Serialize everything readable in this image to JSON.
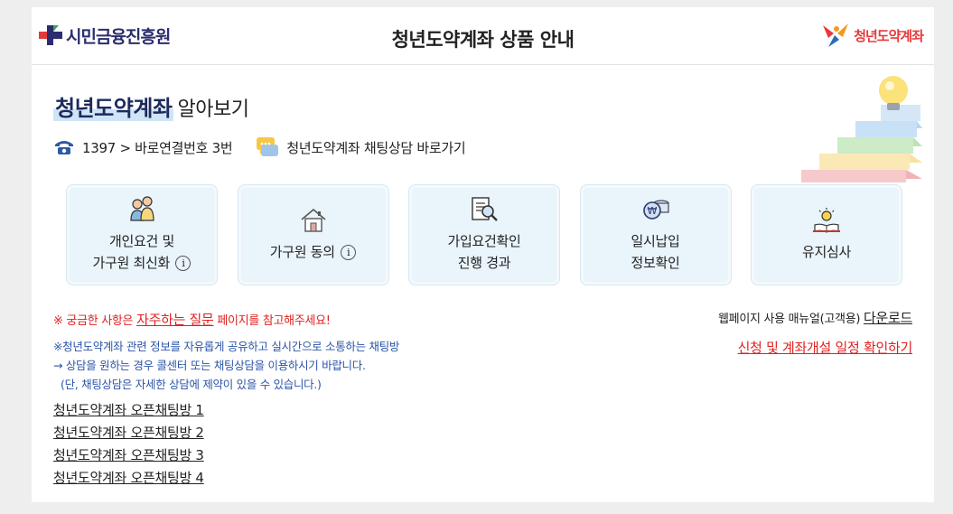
{
  "header": {
    "left_logo_text": "시민금융진흥원",
    "title": "청년도약계좌 상품 안내",
    "right_logo_text": "청년도약계좌"
  },
  "intro": {
    "title_highlight": "청년도약계좌",
    "title_rest": "알아보기"
  },
  "contact": {
    "phone_text": "1397 > 바로연결번호 3번",
    "chat_text": "청년도약계좌 채팅상담 바로가기"
  },
  "cards": [
    {
      "icon": "family-icon",
      "line1": "개인요건 및",
      "line2": "가구원 최신화",
      "info": "i"
    },
    {
      "icon": "house-icon",
      "line1": "가구원 동의",
      "line2": "",
      "info": "i"
    },
    {
      "icon": "document-search-icon",
      "line1": "가입요건확인",
      "line2": "진행 경과",
      "info": ""
    },
    {
      "icon": "won-coins-icon",
      "line1": "일시납입",
      "line2": "정보확인",
      "info": ""
    },
    {
      "icon": "lightbulb-book-icon",
      "line1": "유지심사",
      "line2": "",
      "info": ""
    }
  ],
  "faq": {
    "prefix": "※ 궁금한 사항은",
    "link": "자주하는 질문",
    "suffix": "페이지를 참고해주세요!"
  },
  "manual": {
    "prefix": "웹페이지 사용 매뉴얼(고객용)",
    "link": "다운로드"
  },
  "schedule_link": "신청 및 계좌개설 일정 확인하기",
  "notice": {
    "line1": "※청년도약계좌 관련 정보를 자유롭게 공유하고 실시간으로 소통하는 채팅방",
    "line2": "→ 상담을 원하는 경우 콜센터 또는 채팅상담을 이용하시기 바랍니다.",
    "line3": "(단, 채팅상담은 자세한 상담에 제약이 있을 수 있습니다.)"
  },
  "rooms": [
    "청년도약계좌 오픈채팅방 1",
    "청년도약계좌 오픈채팅방 2",
    "청년도약계좌 오픈채팅방 3",
    "청년도약계좌 오픈채팅방 4"
  ],
  "colors": {
    "navy": "#2b2d6e",
    "red": "#e02020",
    "card_bg": "#e9f4fb",
    "notice_blue": "#2c55a7"
  }
}
